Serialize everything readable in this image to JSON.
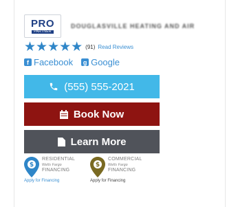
{
  "brand": {
    "logo_text": "PRO",
    "logo_subtext": "PARTNER",
    "company_name": "DOUGLASVILLE HEATING AND AIR"
  },
  "rating": {
    "stars": "★★★★★",
    "count": "(91)",
    "read_reviews_label": "Read Reviews"
  },
  "social": {
    "facebook_label": "Facebook",
    "google_label": "Google"
  },
  "actions": {
    "phone_label": "(555) 555-2021",
    "book_label": "Book Now",
    "learn_label": "Learn More"
  },
  "financing": [
    {
      "line1": "RESIDENTIAL",
      "line2": "Wells Fargo",
      "line3": "FINANCING",
      "link": "Apply for Financing",
      "color": "#2f86c8"
    },
    {
      "line1": "COMMERCIAL",
      "line2": "Wells Fargo",
      "line3": "FINANCING",
      "link": "Apply for Financing",
      "color": "#7a6a22"
    }
  ],
  "colors": {
    "accent_blue": "#42b8e8",
    "book_red": "#8e1411",
    "learn_gray": "#50535a",
    "star_blue": "#2f86c8"
  }
}
